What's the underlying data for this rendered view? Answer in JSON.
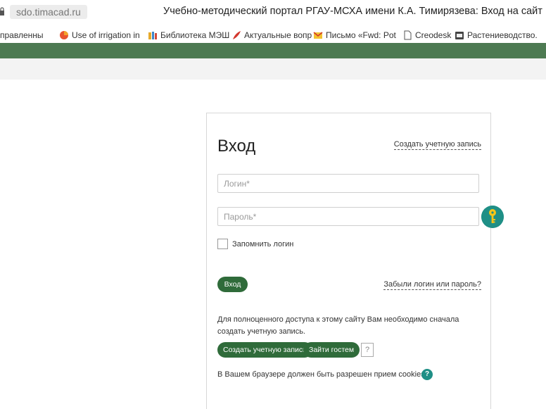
{
  "browser": {
    "url": "sdo.timacad.ru",
    "window_title": "Учебно-методический портал РГАУ-МСХА имени К.А. Тимирязева: Вход на сайт"
  },
  "bookmarks": [
    {
      "label": "правленны",
      "icon": "folder-icon"
    },
    {
      "label": "Use of irrigation in",
      "icon": "colorful-circle-icon"
    },
    {
      "label": "Библиотека МЭШ",
      "icon": "books-icon"
    },
    {
      "label": "Актуальные вопр",
      "icon": "feather-icon"
    },
    {
      "label": "Письмо «Fwd: Pot",
      "icon": "mail-icon"
    },
    {
      "label": "Creodesk",
      "icon": "page-icon"
    },
    {
      "label": "Растениеводство.",
      "icon": "book-icon"
    }
  ],
  "login": {
    "heading": "Вход",
    "create_account_link": "Создать учетную запись",
    "username_placeholder": "Логин*",
    "password_placeholder": "Пароль*",
    "remember_label": "Запомнить логин",
    "submit_label": "Вход",
    "forgot_link": "Забыли логин или пароль?",
    "info_text": "Для полноценного доступа к этому сайту Вам необходимо сначала создать учетную запись.",
    "create_button": "Создать учетную запись",
    "guest_button": "Зайти гостем",
    "help_label": "?",
    "cookies_text": "В Вашем браузере должен быть разрешен прием cookies",
    "cookies_help": "?"
  },
  "colors": {
    "header_green": "#4d7a52",
    "button_green": "#2f6b3a",
    "teal_badge": "#1f8f86",
    "key_yellow": "#f5c518"
  }
}
